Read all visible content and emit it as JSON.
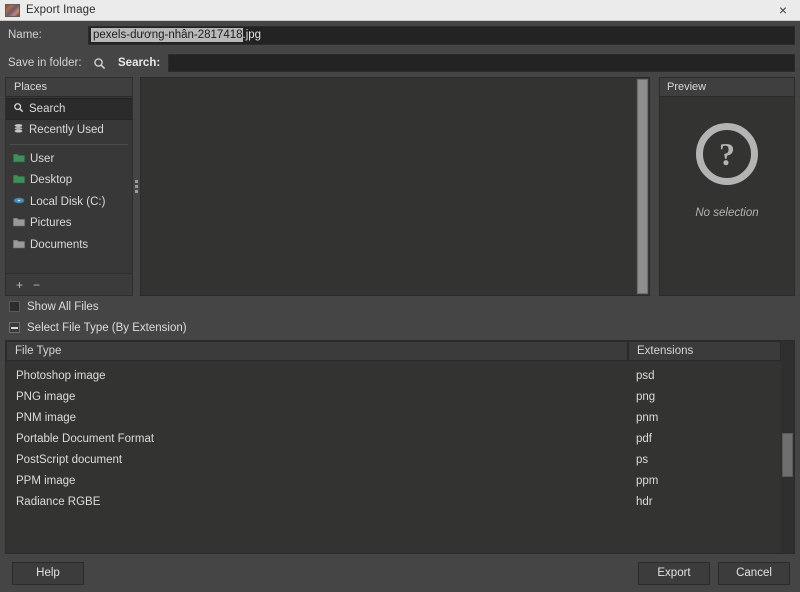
{
  "window": {
    "title": "Export Image",
    "icon": "image-thumbnail-icon",
    "close_label": "×"
  },
  "name_row": {
    "label": "Name:",
    "value_selected": "pexels-dương-nhân-2817418",
    "value_rest": ".jpg",
    "full_value": "pexels-dương-nhân-2817418.jpg"
  },
  "folder_row": {
    "label": "Save in folder:",
    "search_label": "Search:",
    "search_value": "",
    "search_placeholder": ""
  },
  "places": {
    "header": "Places",
    "items": [
      {
        "label": "Search",
        "icon": "search-icon",
        "selected": true
      },
      {
        "label": "Recently Used",
        "icon": "recent-icon",
        "selected": false
      },
      {
        "label": "User",
        "icon": "folder-icon",
        "selected": false
      },
      {
        "label": "Desktop",
        "icon": "folder-icon",
        "selected": false
      },
      {
        "label": "Local Disk (C:)",
        "icon": "drive-icon",
        "selected": false
      },
      {
        "label": "Pictures",
        "icon": "folder-icon",
        "selected": false
      },
      {
        "label": "Documents",
        "icon": "folder-icon",
        "selected": false
      }
    ],
    "add_label": "+",
    "remove_label": "−"
  },
  "preview": {
    "header": "Preview",
    "icon": "question-mark-icon",
    "glyph": "?",
    "status": "No selection"
  },
  "options": {
    "show_all_files": "Show All Files",
    "show_all_files_checked": false,
    "select_file_type": "Select File Type (By Extension)",
    "select_file_type_expanded": true
  },
  "filetype_table": {
    "columns": [
      "File Type",
      "Extensions"
    ],
    "rows": [
      {
        "type": "Photoshop image",
        "ext": "psd"
      },
      {
        "type": "PNG image",
        "ext": "png"
      },
      {
        "type": "PNM image",
        "ext": "pnm"
      },
      {
        "type": "Portable Document Format",
        "ext": "pdf"
      },
      {
        "type": "PostScript document",
        "ext": "ps"
      },
      {
        "type": "PPM image",
        "ext": "ppm"
      },
      {
        "type": "Radiance RGBE",
        "ext": "hdr"
      }
    ]
  },
  "footer": {
    "help": "Help",
    "export": "Export",
    "cancel": "Cancel"
  },
  "colors": {
    "window_bg": "#454545",
    "titlebar_bg": "#ebebeb",
    "field_bg": "#232323",
    "panel_bg": "#333331",
    "selection_bg": "#b9b9b9",
    "text": "#dcdcdc"
  }
}
